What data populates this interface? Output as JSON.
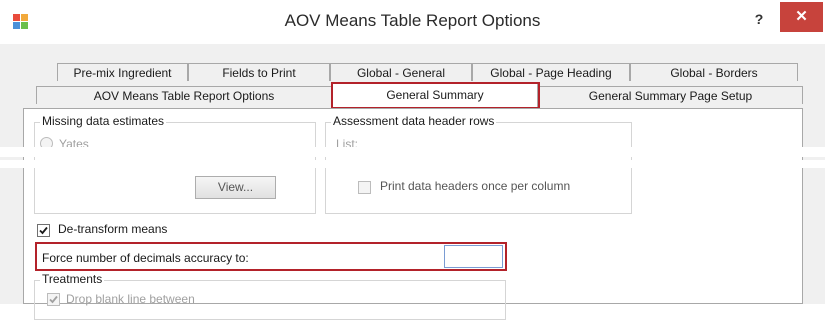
{
  "window": {
    "title": "AOV Means Table Report Options",
    "help_label": "?",
    "close_label": "✕",
    "icon": "app-grid-icon"
  },
  "tabs": {
    "row1": [
      {
        "label": "Pre-mix Ingredient"
      },
      {
        "label": "Fields to Print"
      },
      {
        "label": "Global - General"
      },
      {
        "label": "Global - Page Heading"
      },
      {
        "label": "Global - Borders"
      }
    ],
    "row2": [
      {
        "label": "AOV Means Table Report Options"
      },
      {
        "label": "General Summary",
        "selected": true
      },
      {
        "label": "General Summary Page Setup"
      }
    ]
  },
  "missing_data": {
    "legend": "Missing data estimates",
    "option_yates": "Yates",
    "view_button": "View..."
  },
  "assessment_headers": {
    "legend": "Assessment data header rows",
    "list_label": "List:",
    "print_once_label": "Print data headers once per column",
    "print_once_checked": false
  },
  "detransform": {
    "label": "De-transform means",
    "checked": true
  },
  "decimals": {
    "label": "Force number of decimals accuracy to:",
    "value": ""
  },
  "treatments": {
    "legend": "Treatments",
    "drop_blank_label": "Drop blank line between",
    "drop_blank_checked": true
  },
  "colors": {
    "highlight": "#b3222a",
    "close_button": "#c7433c",
    "dialog_bg": "#f0f0f0"
  }
}
